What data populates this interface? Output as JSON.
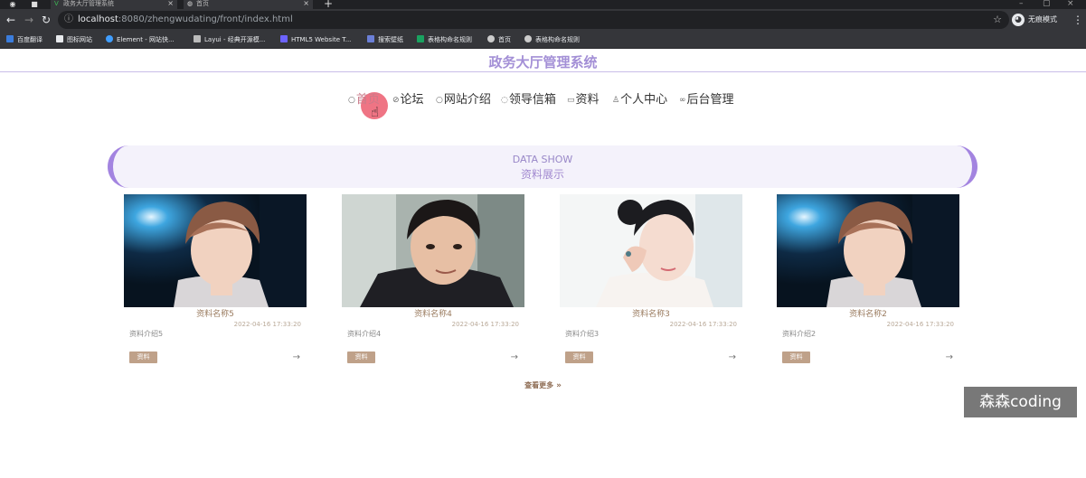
{
  "browser": {
    "tabs": [
      {
        "label": "政务大厅管理系统",
        "active": false
      },
      {
        "label": "首页",
        "active": true
      }
    ],
    "new_tab": "+",
    "address": {
      "host": "localhost",
      "path": ":8080/zhengwudating/front/index.html"
    },
    "profile_label": "无痕模式",
    "bookmarks": [
      "百度翻译",
      "图标网站",
      "Element - 网站快...",
      "Layui - 经典开源模...",
      "HTML5 Website T...",
      "搜索壁纸",
      "表格构命名规则",
      "首页",
      "表格构命名规则"
    ]
  },
  "site": {
    "title": "政务大厅管理系统",
    "nav": [
      {
        "label": "首页"
      },
      {
        "label": "论坛"
      },
      {
        "label": "网站介绍"
      },
      {
        "label": "领导信箱"
      },
      {
        "label": "资料"
      },
      {
        "label": "个人中心"
      },
      {
        "label": "后台管理"
      }
    ]
  },
  "banner": {
    "en": "DATA SHOW",
    "cn": "资料展示"
  },
  "cards": [
    {
      "name": "资料名称5",
      "time": "2022-04-16 17:33:20",
      "intro": "资料介绍5",
      "tag": "资料",
      "arrow": "→"
    },
    {
      "name": "资料名称4",
      "time": "2022-04-16 17:33:20",
      "intro": "资料介绍4",
      "tag": "资料",
      "arrow": "→"
    },
    {
      "name": "资料名称3",
      "time": "2022-04-16 17:33:20",
      "intro": "资料介绍3",
      "tag": "资料",
      "arrow": "→"
    },
    {
      "name": "资料名称2",
      "time": "2022-04-16 17:33:20",
      "intro": "资料介绍2",
      "tag": "资料",
      "arrow": "→"
    }
  ],
  "more_label": "查看更多",
  "watermark": "森森coding",
  "colors": {
    "accent": "#a384e0",
    "tag": "#bfa189",
    "title": "#a38fd6"
  }
}
